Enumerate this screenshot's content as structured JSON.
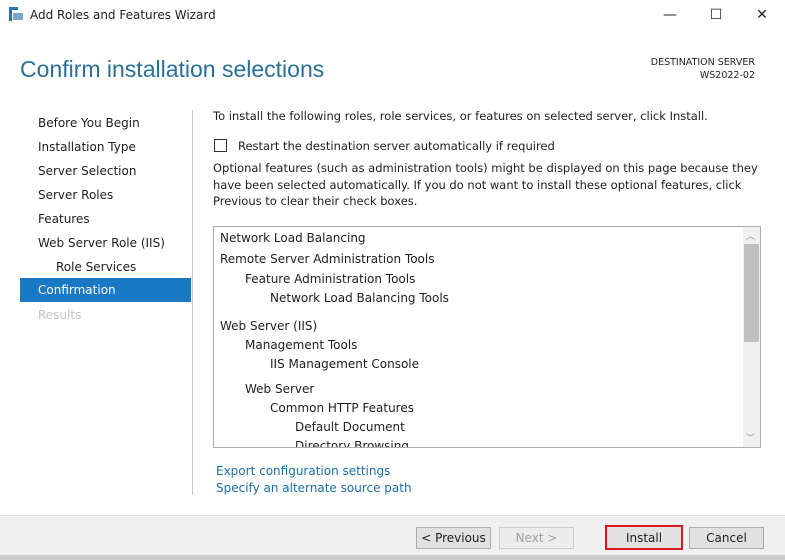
{
  "window": {
    "title": "Add Roles and Features Wizard",
    "minimize": "—",
    "maximize": "☐",
    "close": "✕"
  },
  "header": {
    "title": "Confirm installation selections",
    "dest_label": "DESTINATION SERVER",
    "dest_server": "WS2022-02"
  },
  "nav": [
    "Before You Begin",
    "Installation Type",
    "Server Selection",
    "Server Roles",
    "Features",
    "Web Server Role (IIS)",
    "Role Services",
    "Confirmation",
    "Results"
  ],
  "content": {
    "intro": "To install the following roles, role services, or features on selected server, click Install.",
    "restart_label": "Restart the destination server automatically if required",
    "restart_checked": false,
    "optional_note": "Optional features (such as administration tools) might be displayed on this page because they have been selected automatically. If you do not want to install these optional features, click Previous to clear their check boxes.",
    "items": [
      {
        "label": "Network Load Balancing",
        "level": 0
      },
      {
        "label": "Remote Server Administration Tools",
        "level": 0
      },
      {
        "label": "Feature Administration Tools",
        "level": 1
      },
      {
        "label": "Network Load Balancing Tools",
        "level": 2
      },
      {
        "label": "Web Server (IIS)",
        "level": 0
      },
      {
        "label": "Management Tools",
        "level": 1
      },
      {
        "label": "IIS Management Console",
        "level": 2
      },
      {
        "label": "Web Server",
        "level": 1
      },
      {
        "label": "Common HTTP Features",
        "level": 2
      },
      {
        "label": "Default Document",
        "level": 3
      },
      {
        "label": "Directory Browsing",
        "level": 3
      }
    ],
    "export_link": "Export configuration settings",
    "source_link": "Specify an alternate source path"
  },
  "buttons": {
    "previous": "< Previous",
    "next": "Next >",
    "install": "Install",
    "cancel": "Cancel"
  },
  "colors": {
    "accent": "#1a79c5",
    "heading": "#2a6f97",
    "install_highlight": "#e0161e"
  }
}
